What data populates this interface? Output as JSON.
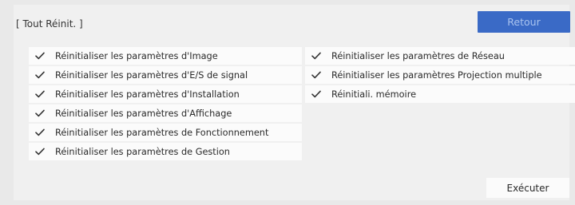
{
  "dialog": {
    "title": "[ Tout Réinit. ]",
    "back_label": "Retour",
    "execute_label": "Exécuter"
  },
  "left_items": [
    {
      "label": "Réinitialiser les paramètres d'Image",
      "icon": "checkmark-icon",
      "checked": true
    },
    {
      "label": "Réinitialiser les paramètres d'E/S de signal",
      "icon": "checkmark-icon",
      "checked": true
    },
    {
      "label": "Réinitialiser les paramètres d'Installation",
      "icon": "checkmark-icon",
      "checked": true
    },
    {
      "label": "Réinitialiser les paramètres d'Affichage",
      "icon": "checkmark-icon",
      "checked": true
    },
    {
      "label": "Réinitialiser les paramètres de Fonctionnement",
      "icon": "checkmark-icon",
      "checked": true
    },
    {
      "label": "Réinitialiser les paramètres de Gestion",
      "icon": "checkmark-icon",
      "checked": true
    }
  ],
  "right_items": [
    {
      "label": "Réinitialiser les paramètres de Réseau",
      "icon": "checkmark-icon",
      "checked": true
    },
    {
      "label": "Réinitialiser les paramètres Projection multiple",
      "icon": "checkmark-icon",
      "checked": true
    },
    {
      "label": "Réinitiali. mémoire",
      "icon": "checkmark-icon",
      "checked": true
    }
  ],
  "colors": {
    "background": "#e9e9e9",
    "panel": "#f0f0f0",
    "item_background": "#fbfbfb",
    "accent": "#3a6ac6",
    "accent_text": "#a9c3ef"
  }
}
